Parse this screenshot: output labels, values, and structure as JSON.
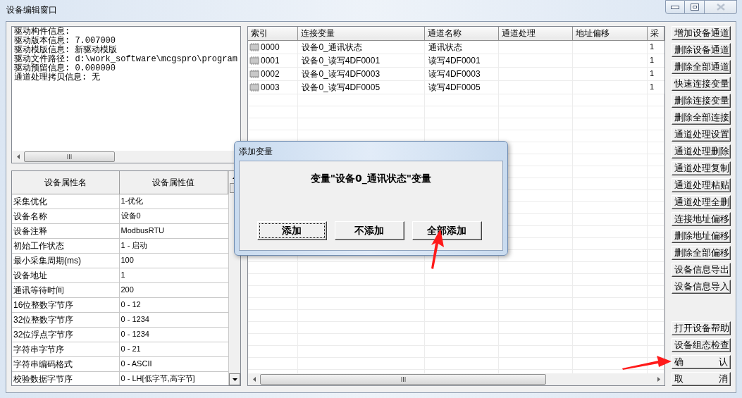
{
  "window": {
    "title": "设备编辑窗口"
  },
  "info_panel": {
    "lines": [
      "驱动构件信息:",
      "驱动版本信息: 7.007000",
      "驱动模版信息: 新驱动模版",
      "驱动文件路径: d:\\work_software\\mcgspro\\program",
      "驱动预留信息: 0.000000",
      "通道处理拷贝信息: 无"
    ]
  },
  "properties": {
    "columns": [
      "设备属性名",
      "设备属性值"
    ],
    "rows": [
      {
        "name": "采集优化",
        "value": "1-优化"
      },
      {
        "name": "设备名称",
        "value": "设备0"
      },
      {
        "name": "设备注释",
        "value": "ModbusRTU"
      },
      {
        "name": "初始工作状态",
        "value": "1 - 启动"
      },
      {
        "name": "最小采集周期(ms)",
        "value": "100"
      },
      {
        "name": "设备地址",
        "value": "1"
      },
      {
        "name": "通讯等待时间",
        "value": "200"
      },
      {
        "name": "16位整数字节序",
        "value": "0 - 12"
      },
      {
        "name": "32位整数字节序",
        "value": "0 - 1234"
      },
      {
        "name": "32位浮点字节序",
        "value": "0 - 1234"
      },
      {
        "name": "字符串字节序",
        "value": "0 - 21"
      },
      {
        "name": "字符串编码格式",
        "value": "0 - ASCII"
      },
      {
        "name": "校验数据字节序",
        "value": "0 - LH[低字节,高字节]"
      }
    ]
  },
  "channels": {
    "columns": [
      "索引",
      "连接变量",
      "通道名称",
      "通道处理",
      "地址偏移",
      "采"
    ],
    "rows": [
      {
        "index": "0000",
        "variable": "设备0_通讯状态",
        "channel_name": "通讯状态",
        "column_6": "1"
      },
      {
        "index": "0001",
        "variable": "设备0_读写4DF0001",
        "channel_name": "读写4DF0001",
        "column_6": "1"
      },
      {
        "index": "0002",
        "variable": "设备0_读写4DF0003",
        "channel_name": "读写4DF0003",
        "column_6": "1"
      },
      {
        "index": "0003",
        "variable": "设备0_读写4DF0005",
        "channel_name": "读写4DF0005",
        "column_6": "1"
      }
    ]
  },
  "side_buttons": [
    "增加设备通道",
    "删除设备通道",
    "删除全部通道",
    "快速连接变量",
    "删除连接变量",
    "删除全部连接",
    "通道处理设置",
    "通道处理删除",
    "通道处理复制",
    "通道处理粘贴",
    "通道处理全删",
    "连接地址偏移",
    "删除地址偏移",
    "删除全部偏移",
    "设备信息导出",
    "设备信息导入"
  ],
  "bottom_buttons": [
    "打开设备帮助",
    "设备组态检查",
    "确 认",
    "取 消"
  ],
  "dialog": {
    "title": "添加变量",
    "message": "变量\"设备0_通讯状态\"变量",
    "buttons": [
      {
        "label": "添加",
        "focused": true
      },
      {
        "label": "不添加",
        "focused": false
      },
      {
        "label": "全部添加",
        "focused": false
      }
    ]
  }
}
